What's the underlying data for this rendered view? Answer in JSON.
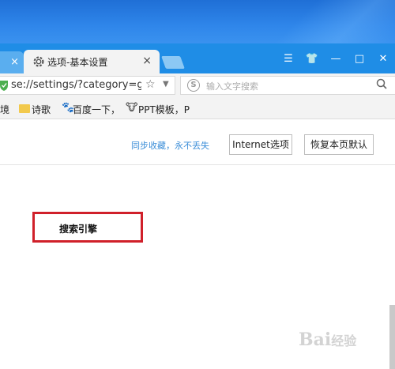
{
  "browser": {
    "tabs": [
      {
        "label": "",
        "close": "×"
      },
      {
        "label": "选项-基本设置",
        "close": "×",
        "active": true
      }
    ],
    "window_controls": [
      "☰",
      "👕",
      "—",
      "□",
      "✕"
    ],
    "address": {
      "url": "se://settings/?category=ger",
      "star": "☆",
      "dropdown": "▼"
    },
    "search": {
      "logo": "S",
      "placeholder": "输入文字搜索",
      "icon": "🔍"
    },
    "bookmarks": [
      {
        "label": "境",
        "icon": ""
      },
      {
        "label": "诗歌",
        "icon": "folder-icon"
      },
      {
        "label": "百度一下，",
        "icon": "paw-icon"
      },
      {
        "label": "PPT模板，P",
        "icon": "ppt-icon"
      }
    ]
  },
  "settings": {
    "sync_link": "同步收藏，永不丢失",
    "internet_options_button": "Internet选项",
    "restore_button": "恢复本页默认",
    "search_engine_label": "搜索引擎"
  },
  "watermark": {
    "text": "Bai",
    "suffix": "经验"
  },
  "colors": {
    "tabstrip": "#1f8de6",
    "highlight": "#d0202a",
    "link": "#3b8ed8"
  }
}
